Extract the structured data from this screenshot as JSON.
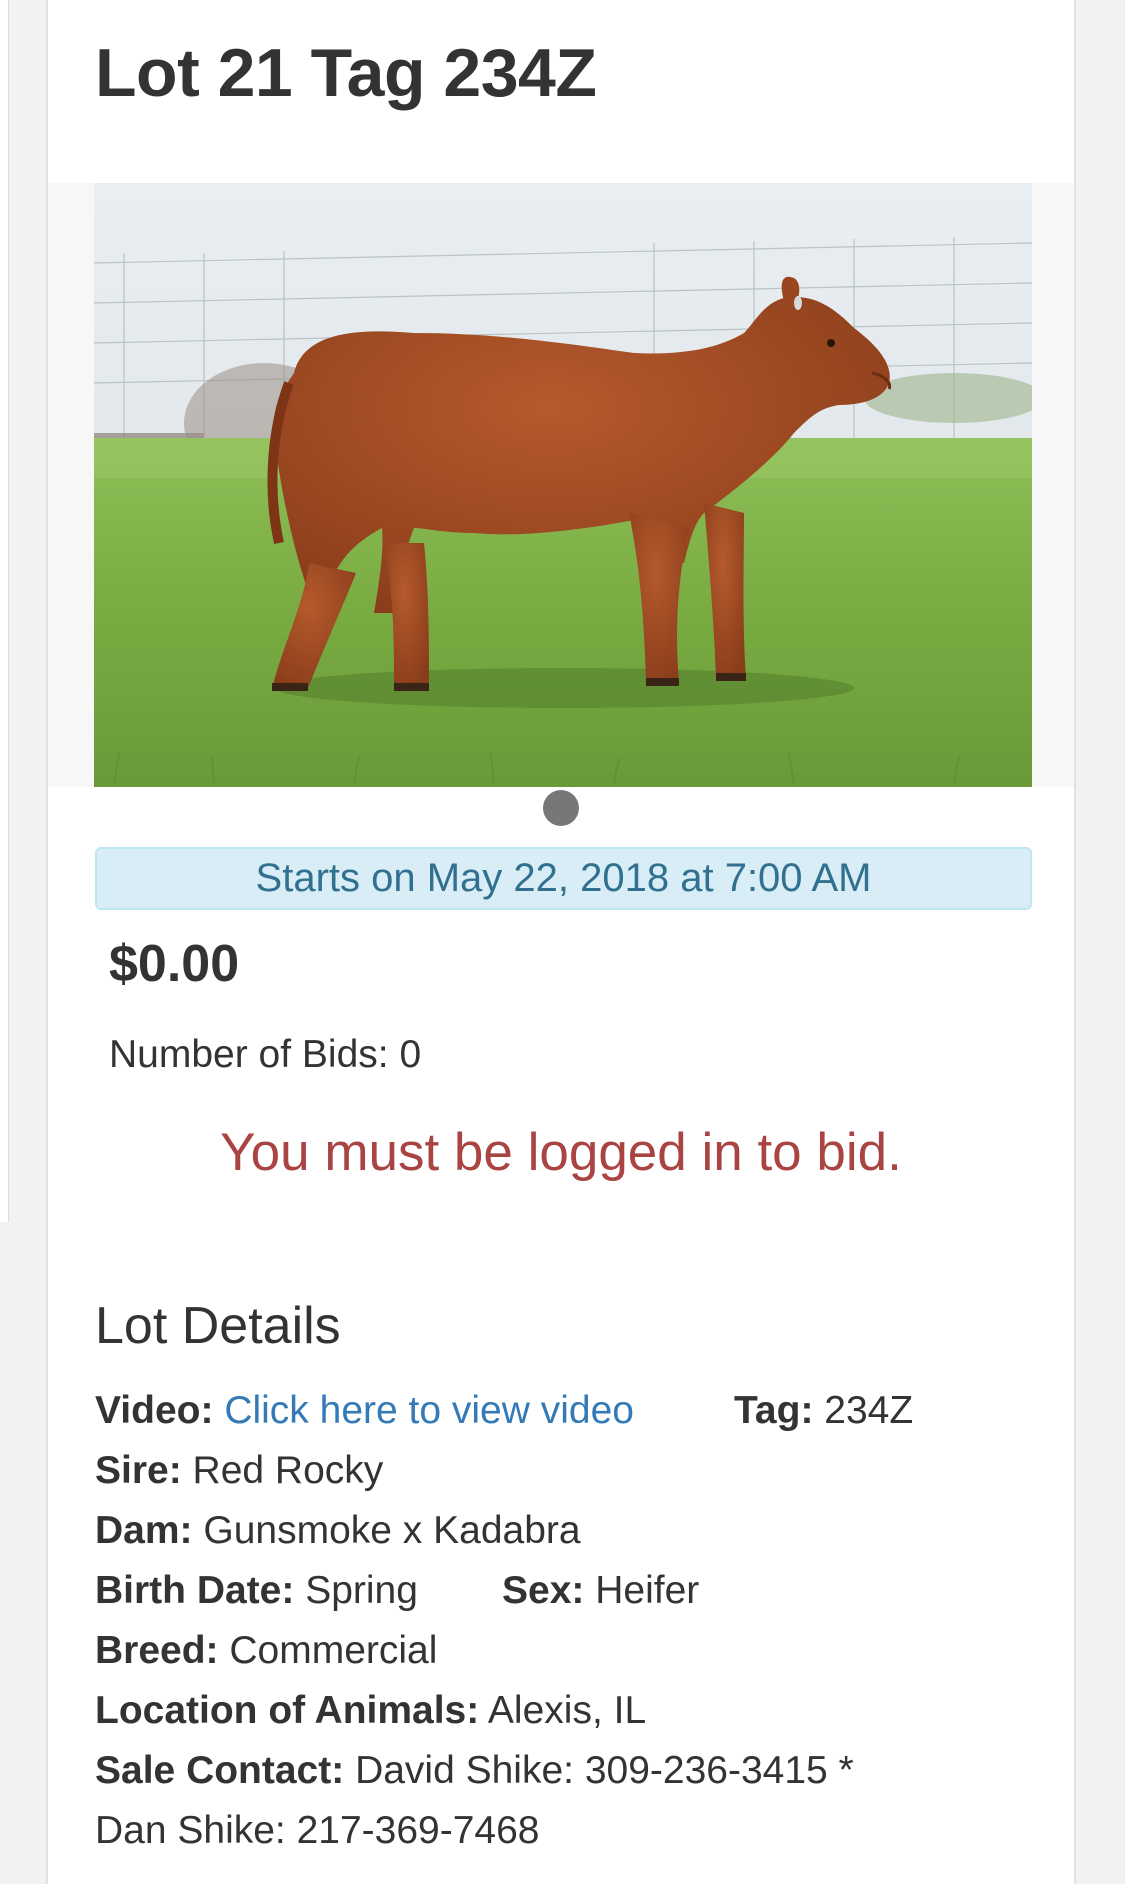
{
  "lot": {
    "title": "Lot 21 Tag 234Z"
  },
  "auction": {
    "start_notice": "Starts on May 22, 2018 at 7:00 AM",
    "current_price": "$0.00",
    "bids_text": "Number of Bids: 0",
    "login_notice": "You must be logged in to bid."
  },
  "details": {
    "heading": "Lot Details",
    "video_label": "Video:",
    "video_link": "Click here to view video",
    "tag_label": "Tag:",
    "tag_value": "234Z",
    "sire_label": "Sire:",
    "sire_value": "Red Rocky",
    "dam_label": "Dam:",
    "dam_value": "Gunsmoke x Kadabra",
    "birth_label": "Birth Date:",
    "birth_value": "Spring",
    "sex_label": "Sex:",
    "sex_value": "Heifer",
    "breed_label": "Breed:",
    "breed_value": "Commercial",
    "location_label": "Location of Animals:",
    "location_value": "Alexis, IL",
    "contact_label": "Sale Contact:",
    "contact_value": "David Shike: 309-236-3415 *",
    "contact_value_2": "Dan Shike: 217-369-7468"
  },
  "colors": {
    "alert_bg": "#d9edf7",
    "alert_text": "#31708f",
    "error_text": "#a94442",
    "link": "#337ab7"
  }
}
